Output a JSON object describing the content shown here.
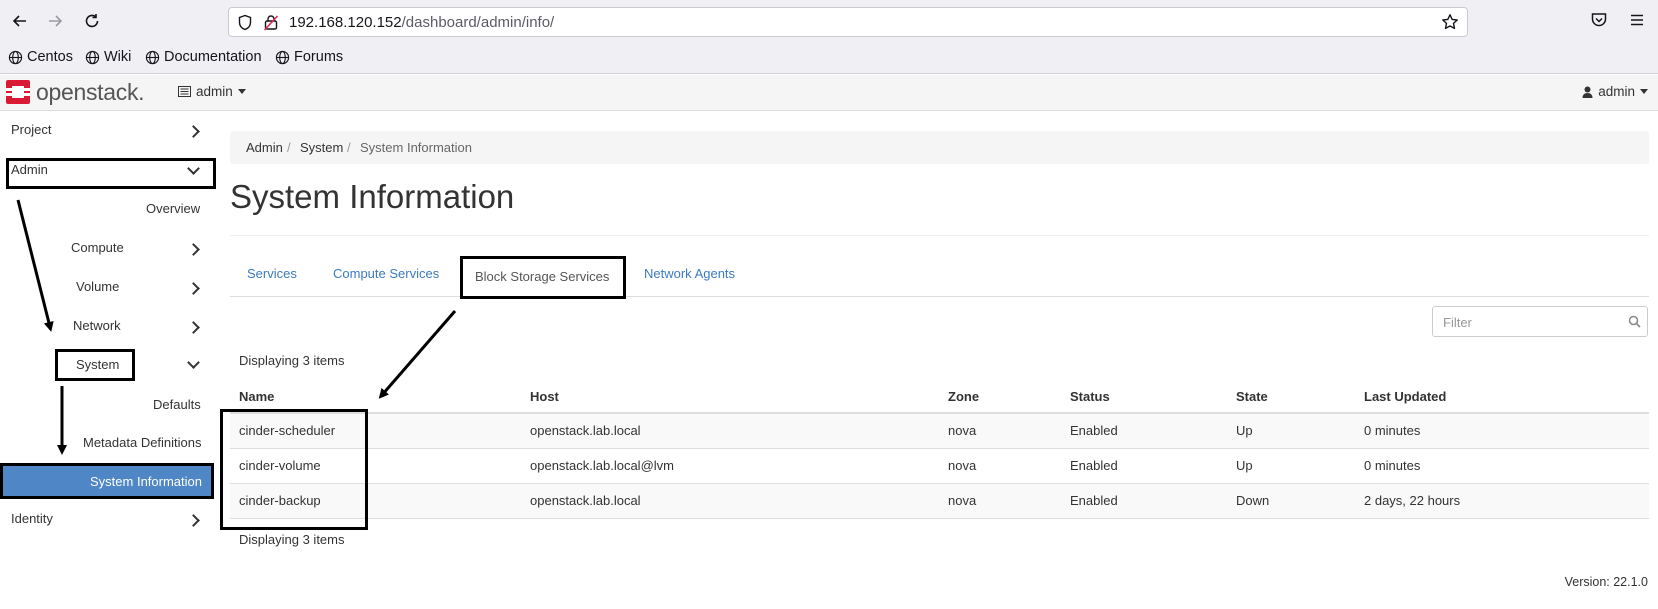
{
  "browser": {
    "url_host": "192.168.120.152",
    "url_path": "/dashboard/admin/info/",
    "bookmarks": [
      "Centos",
      "Wiki",
      "Documentation",
      "Forums"
    ]
  },
  "topbar": {
    "logo_text": "openstack.",
    "project": "admin",
    "user": "admin"
  },
  "sidebar": {
    "project": "Project",
    "admin": "Admin",
    "overview": "Overview",
    "compute": "Compute",
    "volume": "Volume",
    "network": "Network",
    "system": "System",
    "defaults": "Defaults",
    "metadata": "Metadata Definitions",
    "system_info": "System Information",
    "identity": "Identity"
  },
  "breadcrumb": [
    "Admin",
    "System",
    "System Information"
  ],
  "page_title": "System Information",
  "tabs": [
    "Services",
    "Compute Services",
    "Block Storage Services",
    "Network Agents"
  ],
  "active_tab": "Block Storage Services",
  "filter_placeholder": "Filter",
  "count_label": "Displaying 3 items",
  "table": {
    "headers": [
      "Name",
      "Host",
      "Zone",
      "Status",
      "State",
      "Last Updated"
    ],
    "rows": [
      [
        "cinder-scheduler",
        "openstack.lab.local",
        "nova",
        "Enabled",
        "Up",
        "0 minutes"
      ],
      [
        "cinder-volume",
        "openstack.lab.local@lvm",
        "nova",
        "Enabled",
        "Up",
        "0 minutes"
      ],
      [
        "cinder-backup",
        "openstack.lab.local",
        "nova",
        "Enabled",
        "Down",
        "2 days, 22 hours"
      ]
    ]
  },
  "version": "Version: 22.1.0",
  "colors": {
    "accent": "#4f87c6",
    "link": "#3c7ac0",
    "logo_red": "#da1a32"
  }
}
